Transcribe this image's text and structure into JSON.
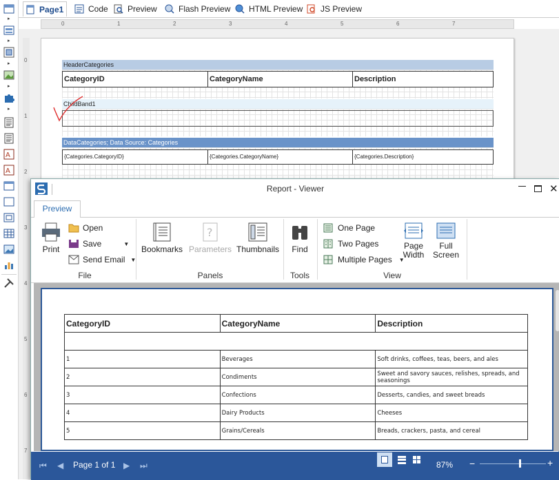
{
  "tabs": [
    {
      "label": "Page1",
      "icon": "page-icon"
    },
    {
      "label": "Code",
      "icon": "code-icon"
    },
    {
      "label": "Preview",
      "icon": "preview-icon"
    },
    {
      "label": "Flash Preview",
      "icon": "flash-preview-icon"
    },
    {
      "label": "HTML Preview",
      "icon": "html-preview-icon"
    },
    {
      "label": "JS Preview",
      "icon": "js-preview-icon"
    }
  ],
  "ruler": {
    "h": [
      "0",
      "1",
      "2",
      "3",
      "4",
      "5",
      "6",
      "7"
    ],
    "v": [
      "0",
      "1",
      "2",
      "3",
      "4",
      "5",
      "6",
      "7"
    ]
  },
  "design": {
    "header_band": "HeaderCategories",
    "header_cols": [
      "CategoryID",
      "CategoryName",
      "Description"
    ],
    "child_band": "ChildBand1",
    "data_band": "DataCategories; Data Source: Categories",
    "data_cols": [
      "{Categories.CategoryID}",
      "{Categories.CategoryName}",
      "{Categories.Description}"
    ]
  },
  "viewer": {
    "title": "Report - Viewer",
    "tab": "Preview",
    "ribbon": {
      "print": "Print",
      "open": "Open",
      "save": "Save",
      "send_email": "Send Email",
      "group_file": "File",
      "bookmarks": "Bookmarks",
      "parameters": "Parameters",
      "thumbnails": "Thumbnails",
      "group_panels": "Panels",
      "find": "Find",
      "group_tools": "Tools",
      "one_page": "One Page",
      "two_pages": "Two Pages",
      "multiple_pages": "Multiple Pages",
      "page_width": "Page Width",
      "full_screen": "Full Screen",
      "group_view": "View"
    },
    "report": {
      "headers": [
        "CategoryID",
        "CategoryName",
        "Description"
      ],
      "rows": [
        [
          "1",
          "Beverages",
          "Soft drinks, coffees, teas, beers, and ales"
        ],
        [
          "2",
          "Condiments",
          "Sweet and savory sauces, relishes, spreads, and seasonings"
        ],
        [
          "3",
          "Confections",
          "Desserts, candies, and sweet breads"
        ],
        [
          "4",
          "Dairy Products",
          "Cheeses"
        ],
        [
          "5",
          "Grains/Cereals",
          "Breads, crackers, pasta, and cereal"
        ]
      ]
    },
    "status": {
      "page": "Page 1 of 1",
      "zoom": "87%",
      "zoom_level": 0.6
    }
  },
  "colors": {
    "accent": "#2b579a",
    "band_header": "#b8cce4",
    "band_child": "#e6f2fa",
    "annotation": "#e03030"
  }
}
